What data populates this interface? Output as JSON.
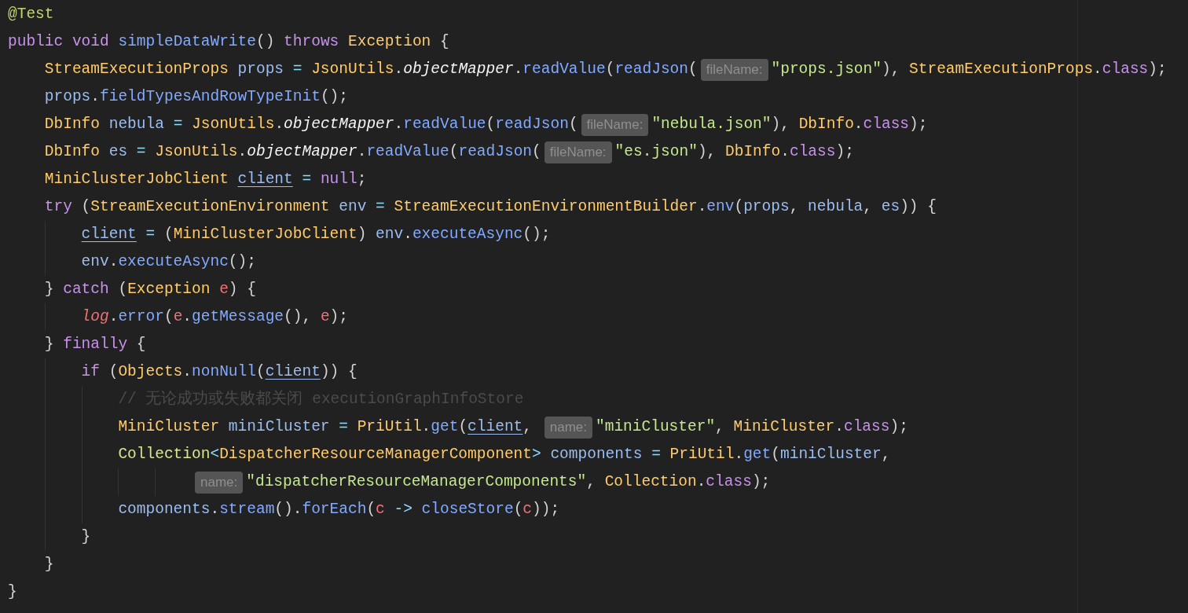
{
  "editor": {
    "lines": [
      {
        "tokens": [
          {
            "kind": "ann",
            "text": "@Test"
          }
        ]
      },
      {
        "tokens": [
          {
            "kind": "kw",
            "text": "public void "
          },
          {
            "kind": "fn",
            "text": "simpleDataWrite"
          },
          {
            "kind": "punct",
            "text": "() "
          },
          {
            "kind": "kw",
            "text": "throws "
          },
          {
            "kind": "type",
            "text": "Exception "
          },
          {
            "kind": "punct",
            "text": "{"
          }
        ],
        "children": [
          {
            "tokens": [
              {
                "kind": "type",
                "text": "StreamExecutionProps "
              },
              {
                "kind": "var",
                "text": "props "
              },
              {
                "kind": "op",
                "text": "= "
              },
              {
                "kind": "type",
                "text": "JsonUtils"
              },
              {
                "kind": "punct",
                "text": "."
              },
              {
                "kind": "field",
                "text": "objectMapper"
              },
              {
                "kind": "punct",
                "text": "."
              },
              {
                "kind": "fn",
                "text": "readValue"
              },
              {
                "kind": "punct",
                "text": "("
              },
              {
                "kind": "fn",
                "text": "readJson"
              },
              {
                "kind": "punct",
                "text": "("
              },
              {
                "kind": "hint",
                "text": "fileName:"
              },
              {
                "kind": "str",
                "text": "\"props.json\""
              },
              {
                "kind": "punct",
                "text": "), "
              },
              {
                "kind": "type",
                "text": "StreamExecutionProps"
              },
              {
                "kind": "punct",
                "text": "."
              },
              {
                "kind": "kw",
                "text": "class"
              },
              {
                "kind": "punct",
                "text": ");"
              }
            ]
          },
          {
            "tokens": [
              {
                "kind": "var",
                "text": "props"
              },
              {
                "kind": "punct",
                "text": "."
              },
              {
                "kind": "fn",
                "text": "fieldTypesAndRowTypeInit"
              },
              {
                "kind": "punct",
                "text": "();"
              }
            ]
          },
          {
            "tokens": [
              {
                "kind": "type",
                "text": "DbInfo "
              },
              {
                "kind": "var",
                "text": "nebula "
              },
              {
                "kind": "op",
                "text": "= "
              },
              {
                "kind": "type",
                "text": "JsonUtils"
              },
              {
                "kind": "punct",
                "text": "."
              },
              {
                "kind": "field",
                "text": "objectMapper"
              },
              {
                "kind": "punct",
                "text": "."
              },
              {
                "kind": "fn",
                "text": "readValue"
              },
              {
                "kind": "punct",
                "text": "("
              },
              {
                "kind": "fn",
                "text": "readJson"
              },
              {
                "kind": "punct",
                "text": "("
              },
              {
                "kind": "hint",
                "text": "fileName:"
              },
              {
                "kind": "str",
                "text": "\"nebula.json\""
              },
              {
                "kind": "punct",
                "text": "), "
              },
              {
                "kind": "type",
                "text": "DbInfo"
              },
              {
                "kind": "punct",
                "text": "."
              },
              {
                "kind": "kw",
                "text": "class"
              },
              {
                "kind": "punct",
                "text": ");"
              }
            ]
          },
          {
            "tokens": [
              {
                "kind": "type",
                "text": "DbInfo "
              },
              {
                "kind": "var",
                "text": "es "
              },
              {
                "kind": "op",
                "text": "= "
              },
              {
                "kind": "type",
                "text": "JsonUtils"
              },
              {
                "kind": "punct",
                "text": "."
              },
              {
                "kind": "field",
                "text": "objectMapper"
              },
              {
                "kind": "punct",
                "text": "."
              },
              {
                "kind": "fn",
                "text": "readValue"
              },
              {
                "kind": "punct",
                "text": "("
              },
              {
                "kind": "fn",
                "text": "readJson"
              },
              {
                "kind": "punct",
                "text": "("
              },
              {
                "kind": "hint",
                "text": "fileName:"
              },
              {
                "kind": "str",
                "text": "\"es.json\""
              },
              {
                "kind": "punct",
                "text": "), "
              },
              {
                "kind": "type",
                "text": "DbInfo"
              },
              {
                "kind": "punct",
                "text": "."
              },
              {
                "kind": "kw",
                "text": "class"
              },
              {
                "kind": "punct",
                "text": ");"
              }
            ]
          },
          {
            "tokens": [
              {
                "kind": "type",
                "text": "MiniClusterJobClient "
              },
              {
                "kind": "ul",
                "text": "client"
              },
              {
                "kind": "op",
                "text": " = "
              },
              {
                "kind": "kw",
                "text": "null"
              },
              {
                "kind": "punct",
                "text": ";"
              }
            ]
          },
          {
            "tokens": [
              {
                "kind": "kw",
                "text": "try "
              },
              {
                "kind": "punct",
                "text": "("
              },
              {
                "kind": "type",
                "text": "StreamExecutionEnvironment "
              },
              {
                "kind": "var",
                "text": "env "
              },
              {
                "kind": "op",
                "text": "= "
              },
              {
                "kind": "type",
                "text": "StreamExecutionEnvironmentBuilder"
              },
              {
                "kind": "punct",
                "text": "."
              },
              {
                "kind": "fn",
                "text": "env"
              },
              {
                "kind": "punct",
                "text": "("
              },
              {
                "kind": "var",
                "text": "props"
              },
              {
                "kind": "punct",
                "text": ", "
              },
              {
                "kind": "var",
                "text": "nebula"
              },
              {
                "kind": "punct",
                "text": ", "
              },
              {
                "kind": "var",
                "text": "es"
              },
              {
                "kind": "punct",
                "text": ")) {"
              }
            ],
            "children": [
              {
                "tokens": [
                  {
                    "kind": "ul",
                    "text": "client"
                  },
                  {
                    "kind": "op",
                    "text": " = "
                  },
                  {
                    "kind": "punct",
                    "text": "("
                  },
                  {
                    "kind": "type",
                    "text": "MiniClusterJobClient"
                  },
                  {
                    "kind": "punct",
                    "text": ") "
                  },
                  {
                    "kind": "var",
                    "text": "env"
                  },
                  {
                    "kind": "punct",
                    "text": "."
                  },
                  {
                    "kind": "fn",
                    "text": "executeAsync"
                  },
                  {
                    "kind": "punct",
                    "text": "();"
                  }
                ]
              },
              {
                "tokens": [
                  {
                    "kind": "var",
                    "text": "env"
                  },
                  {
                    "kind": "punct",
                    "text": "."
                  },
                  {
                    "kind": "fn",
                    "text": "executeAsync"
                  },
                  {
                    "kind": "punct",
                    "text": "();"
                  }
                ]
              }
            ]
          },
          {
            "tokens": [
              {
                "kind": "punct",
                "text": "} "
              },
              {
                "kind": "kw",
                "text": "catch "
              },
              {
                "kind": "punct",
                "text": "("
              },
              {
                "kind": "type",
                "text": "Exception "
              },
              {
                "kind": "red",
                "text": "e"
              },
              {
                "kind": "punct",
                "text": ") {"
              }
            ],
            "children": [
              {
                "tokens": [
                  {
                    "kind": "redi",
                    "text": "log"
                  },
                  {
                    "kind": "punct",
                    "text": "."
                  },
                  {
                    "kind": "fn",
                    "text": "error"
                  },
                  {
                    "kind": "punct",
                    "text": "("
                  },
                  {
                    "kind": "red",
                    "text": "e"
                  },
                  {
                    "kind": "punct",
                    "text": "."
                  },
                  {
                    "kind": "fn",
                    "text": "getMessage"
                  },
                  {
                    "kind": "punct",
                    "text": "(), "
                  },
                  {
                    "kind": "red",
                    "text": "e"
                  },
                  {
                    "kind": "punct",
                    "text": ");"
                  }
                ]
              }
            ]
          },
          {
            "tokens": [
              {
                "kind": "punct",
                "text": "} "
              },
              {
                "kind": "kw",
                "text": "finally "
              },
              {
                "kind": "punct",
                "text": "{"
              }
            ],
            "children": [
              {
                "tokens": [
                  {
                    "kind": "kw",
                    "text": "if "
                  },
                  {
                    "kind": "punct",
                    "text": "("
                  },
                  {
                    "kind": "type",
                    "text": "Objects"
                  },
                  {
                    "kind": "punct",
                    "text": "."
                  },
                  {
                    "kind": "fn",
                    "text": "nonNull"
                  },
                  {
                    "kind": "punct",
                    "text": "("
                  },
                  {
                    "kind": "ul",
                    "text": "client"
                  },
                  {
                    "kind": "punct",
                    "text": ")) {"
                  }
                ],
                "children": [
                  {
                    "tokens": [
                      {
                        "kind": "comment",
                        "text": "// 无论成功或失败都关闭 executionGraphInfoStore"
                      }
                    ]
                  },
                  {
                    "tokens": [
                      {
                        "kind": "type",
                        "text": "MiniCluster "
                      },
                      {
                        "kind": "var",
                        "text": "miniCluster "
                      },
                      {
                        "kind": "op",
                        "text": "= "
                      },
                      {
                        "kind": "type",
                        "text": "PriUtil"
                      },
                      {
                        "kind": "punct",
                        "text": "."
                      },
                      {
                        "kind": "fn",
                        "text": "get"
                      },
                      {
                        "kind": "punct",
                        "text": "("
                      },
                      {
                        "kind": "ul",
                        "text": "client"
                      },
                      {
                        "kind": "punct",
                        "text": ", "
                      },
                      {
                        "kind": "hint",
                        "text": "name:"
                      },
                      {
                        "kind": "str",
                        "text": "\"miniCluster\""
                      },
                      {
                        "kind": "punct",
                        "text": ", "
                      },
                      {
                        "kind": "type",
                        "text": "MiniCluster"
                      },
                      {
                        "kind": "punct",
                        "text": "."
                      },
                      {
                        "kind": "kw",
                        "text": "class"
                      },
                      {
                        "kind": "punct",
                        "text": ");"
                      }
                    ]
                  },
                  {
                    "tokens": [
                      {
                        "kind": "gen",
                        "text": "Collection"
                      },
                      {
                        "kind": "op",
                        "text": "<"
                      },
                      {
                        "kind": "type",
                        "text": "DispatcherResourceManagerComponent"
                      },
                      {
                        "kind": "op",
                        "text": "> "
                      },
                      {
                        "kind": "var",
                        "text": "components "
                      },
                      {
                        "kind": "op",
                        "text": "= "
                      },
                      {
                        "kind": "type",
                        "text": "PriUtil"
                      },
                      {
                        "kind": "punct",
                        "text": "."
                      },
                      {
                        "kind": "fn",
                        "text": "get"
                      },
                      {
                        "kind": "punct",
                        "text": "("
                      },
                      {
                        "kind": "var",
                        "text": "miniCluster"
                      },
                      {
                        "kind": "punct",
                        "text": ","
                      }
                    ],
                    "children": [
                      {
                        "kind": "continuation",
                        "tokens": [
                          {
                            "kind": "hint",
                            "text": "name:"
                          },
                          {
                            "kind": "str",
                            "text": "\"dispatcherResourceManagerComponents\""
                          },
                          {
                            "kind": "punct",
                            "text": ", "
                          },
                          {
                            "kind": "type",
                            "text": "Collection"
                          },
                          {
                            "kind": "punct",
                            "text": "."
                          },
                          {
                            "kind": "kw",
                            "text": "class"
                          },
                          {
                            "kind": "punct",
                            "text": ");"
                          }
                        ]
                      }
                    ]
                  },
                  {
                    "tokens": [
                      {
                        "kind": "var",
                        "text": "components"
                      },
                      {
                        "kind": "punct",
                        "text": "."
                      },
                      {
                        "kind": "fn",
                        "text": "stream"
                      },
                      {
                        "kind": "punct",
                        "text": "()."
                      },
                      {
                        "kind": "fn",
                        "text": "forEach"
                      },
                      {
                        "kind": "punct",
                        "text": "("
                      },
                      {
                        "kind": "red",
                        "text": "c "
                      },
                      {
                        "kind": "op",
                        "text": "-> "
                      },
                      {
                        "kind": "fn",
                        "text": "closeStore"
                      },
                      {
                        "kind": "punct",
                        "text": "("
                      },
                      {
                        "kind": "red",
                        "text": "c"
                      },
                      {
                        "kind": "punct",
                        "text": "));"
                      }
                    ]
                  }
                ]
              },
              {
                "tokens": [
                  {
                    "kind": "punct",
                    "text": "}"
                  }
                ]
              }
            ]
          },
          {
            "tokens": [
              {
                "kind": "punct",
                "text": "}"
              }
            ]
          }
        ]
      },
      {
        "tokens": [
          {
            "kind": "punct",
            "text": "}"
          }
        ]
      }
    ]
  }
}
